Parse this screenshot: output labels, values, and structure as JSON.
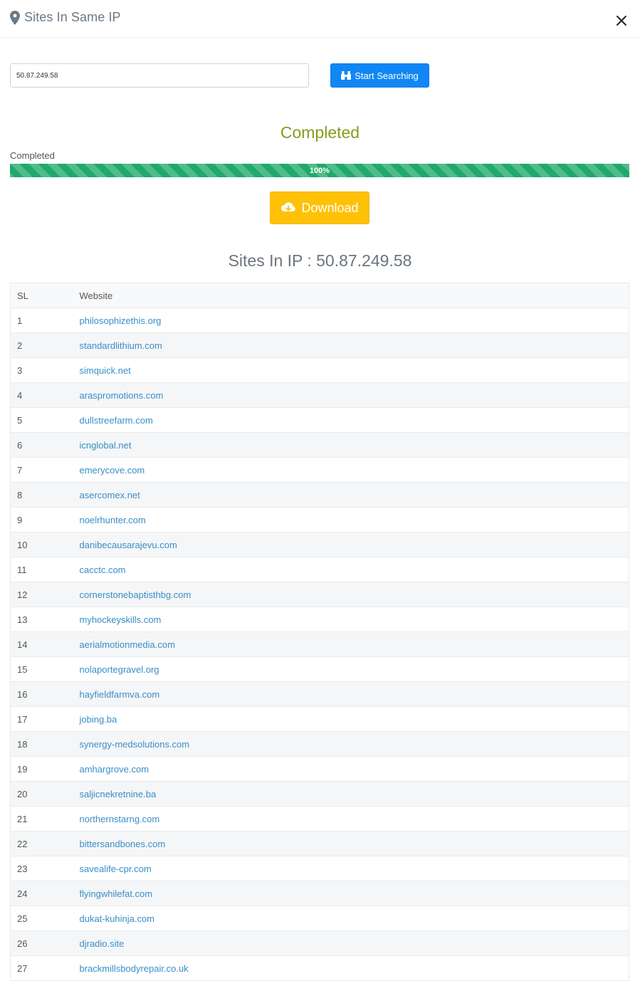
{
  "header": {
    "title": "Sites In Same IP",
    "icon": "map-pin-icon"
  },
  "search": {
    "value": "50.87.249.58",
    "button_label": "Start Searching",
    "button_icon": "binoculars-icon"
  },
  "status": {
    "heading": "Completed",
    "label": "Completed",
    "progress_text": "100%",
    "progress_percent": 100
  },
  "download": {
    "label": "Download",
    "icon": "cloud-download-icon"
  },
  "results": {
    "heading": "Sites In IP : 50.87.249.58",
    "columns": [
      "SL",
      "Website"
    ],
    "rows": [
      {
        "sl": "1",
        "site": "philosophizethis.org"
      },
      {
        "sl": "2",
        "site": "standardlithium.com"
      },
      {
        "sl": "3",
        "site": "simquick.net"
      },
      {
        "sl": "4",
        "site": "araspromotions.com"
      },
      {
        "sl": "5",
        "site": "dullstreefarm.com"
      },
      {
        "sl": "6",
        "site": "icnglobal.net"
      },
      {
        "sl": "7",
        "site": "emerycove.com"
      },
      {
        "sl": "8",
        "site": "asercomex.net"
      },
      {
        "sl": "9",
        "site": "noelrhunter.com"
      },
      {
        "sl": "10",
        "site": "danibecausarajevu.com"
      },
      {
        "sl": "11",
        "site": "cacctc.com"
      },
      {
        "sl": "12",
        "site": "cornerstonebaptisthbg.com"
      },
      {
        "sl": "13",
        "site": "myhockeyskills.com"
      },
      {
        "sl": "14",
        "site": "aerialmotionmedia.com"
      },
      {
        "sl": "15",
        "site": "nolaportegravel.org"
      },
      {
        "sl": "16",
        "site": "hayfieldfarmva.com"
      },
      {
        "sl": "17",
        "site": "jobing.ba"
      },
      {
        "sl": "18",
        "site": "synergy-medsolutions.com"
      },
      {
        "sl": "19",
        "site": "amhargrove.com"
      },
      {
        "sl": "20",
        "site": "saljicnekretnine.ba"
      },
      {
        "sl": "21",
        "site": "northernstarng.com"
      },
      {
        "sl": "22",
        "site": "bittersandbones.com"
      },
      {
        "sl": "23",
        "site": "savealife-cpr.com"
      },
      {
        "sl": "24",
        "site": "flyingwhilefat.com"
      },
      {
        "sl": "25",
        "site": "dukat-kuhinja.com"
      },
      {
        "sl": "26",
        "site": "djradio.site"
      },
      {
        "sl": "27",
        "site": "brackmillsbodyrepair.co.uk"
      }
    ]
  },
  "colors": {
    "primary": "#1087f4",
    "success": "#20a96a",
    "warning": "#ffc107",
    "heading_olive": "#8a9a1c",
    "link": "#3a8ec9"
  }
}
